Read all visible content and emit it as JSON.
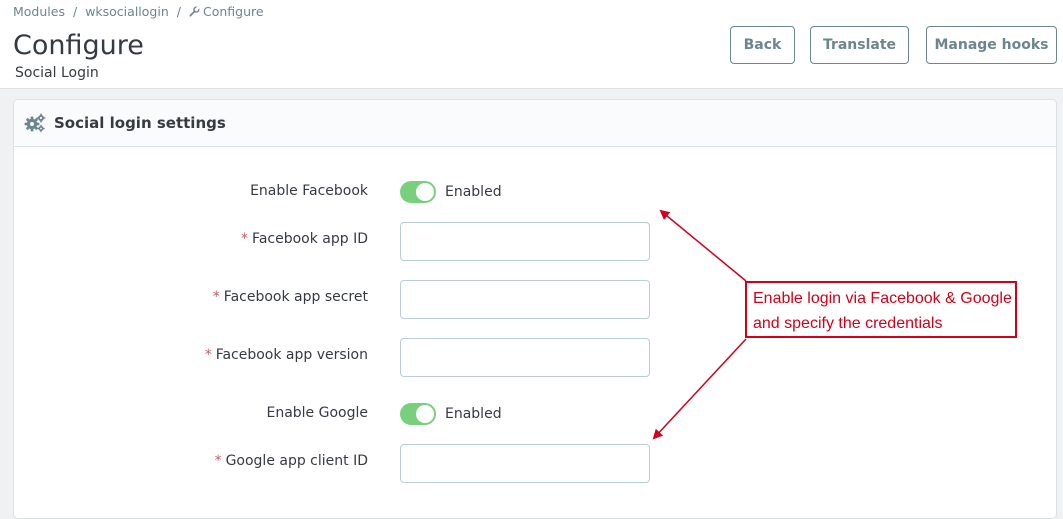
{
  "breadcrumb": {
    "items": [
      "Modules",
      "wksociallogin",
      "Configure"
    ],
    "separator": "/"
  },
  "header": {
    "title": "Configure",
    "subtitle": "Social Login",
    "buttons": {
      "back": "Back",
      "translate": "Translate",
      "manage_hooks": "Manage hooks"
    }
  },
  "panel": {
    "title": "Social login settings",
    "icon": "gears-icon",
    "fields": {
      "enable_facebook": {
        "label": "Enable Facebook",
        "state": "Enabled",
        "enabled": true
      },
      "facebook_app_id": {
        "label": "Facebook app ID",
        "required": "*",
        "value": ""
      },
      "facebook_app_secret": {
        "label": "Facebook app secret",
        "required": "*",
        "value": ""
      },
      "facebook_app_version": {
        "label": "Facebook app version",
        "required": "*",
        "value": ""
      },
      "enable_google": {
        "label": "Enable Google",
        "state": "Enabled",
        "enabled": true
      },
      "google_app_client_id": {
        "label": "Google app client ID",
        "required": "*",
        "value": ""
      }
    }
  },
  "annotation": {
    "line1": "Enable login via Facebook & Google",
    "line2": "and specify the credentials"
  },
  "colors": {
    "toggle_on": "#78d07d",
    "annotation_red": "#d0021b",
    "button_border": "#6c868e",
    "required_star": "#c05c67"
  }
}
